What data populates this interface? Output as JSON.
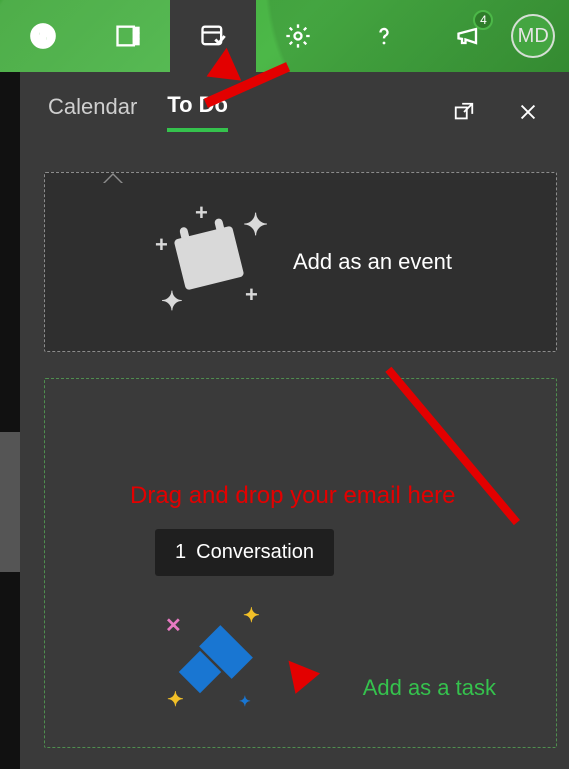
{
  "topbar": {
    "icons": [
      "skype",
      "onenote",
      "todo",
      "settings",
      "help",
      "megaphone"
    ],
    "megaphone_badge": "4",
    "avatar_initials": "MD"
  },
  "panel": {
    "tabs": {
      "calendar": "Calendar",
      "todo": "To Do",
      "active": "todo"
    },
    "event_zone_label": "Add as an event",
    "task_zone_label": "Add as a task",
    "drag_badge_count": "1",
    "drag_badge_text": "Conversation"
  },
  "annotation": {
    "text": "Drag and drop your email here"
  }
}
